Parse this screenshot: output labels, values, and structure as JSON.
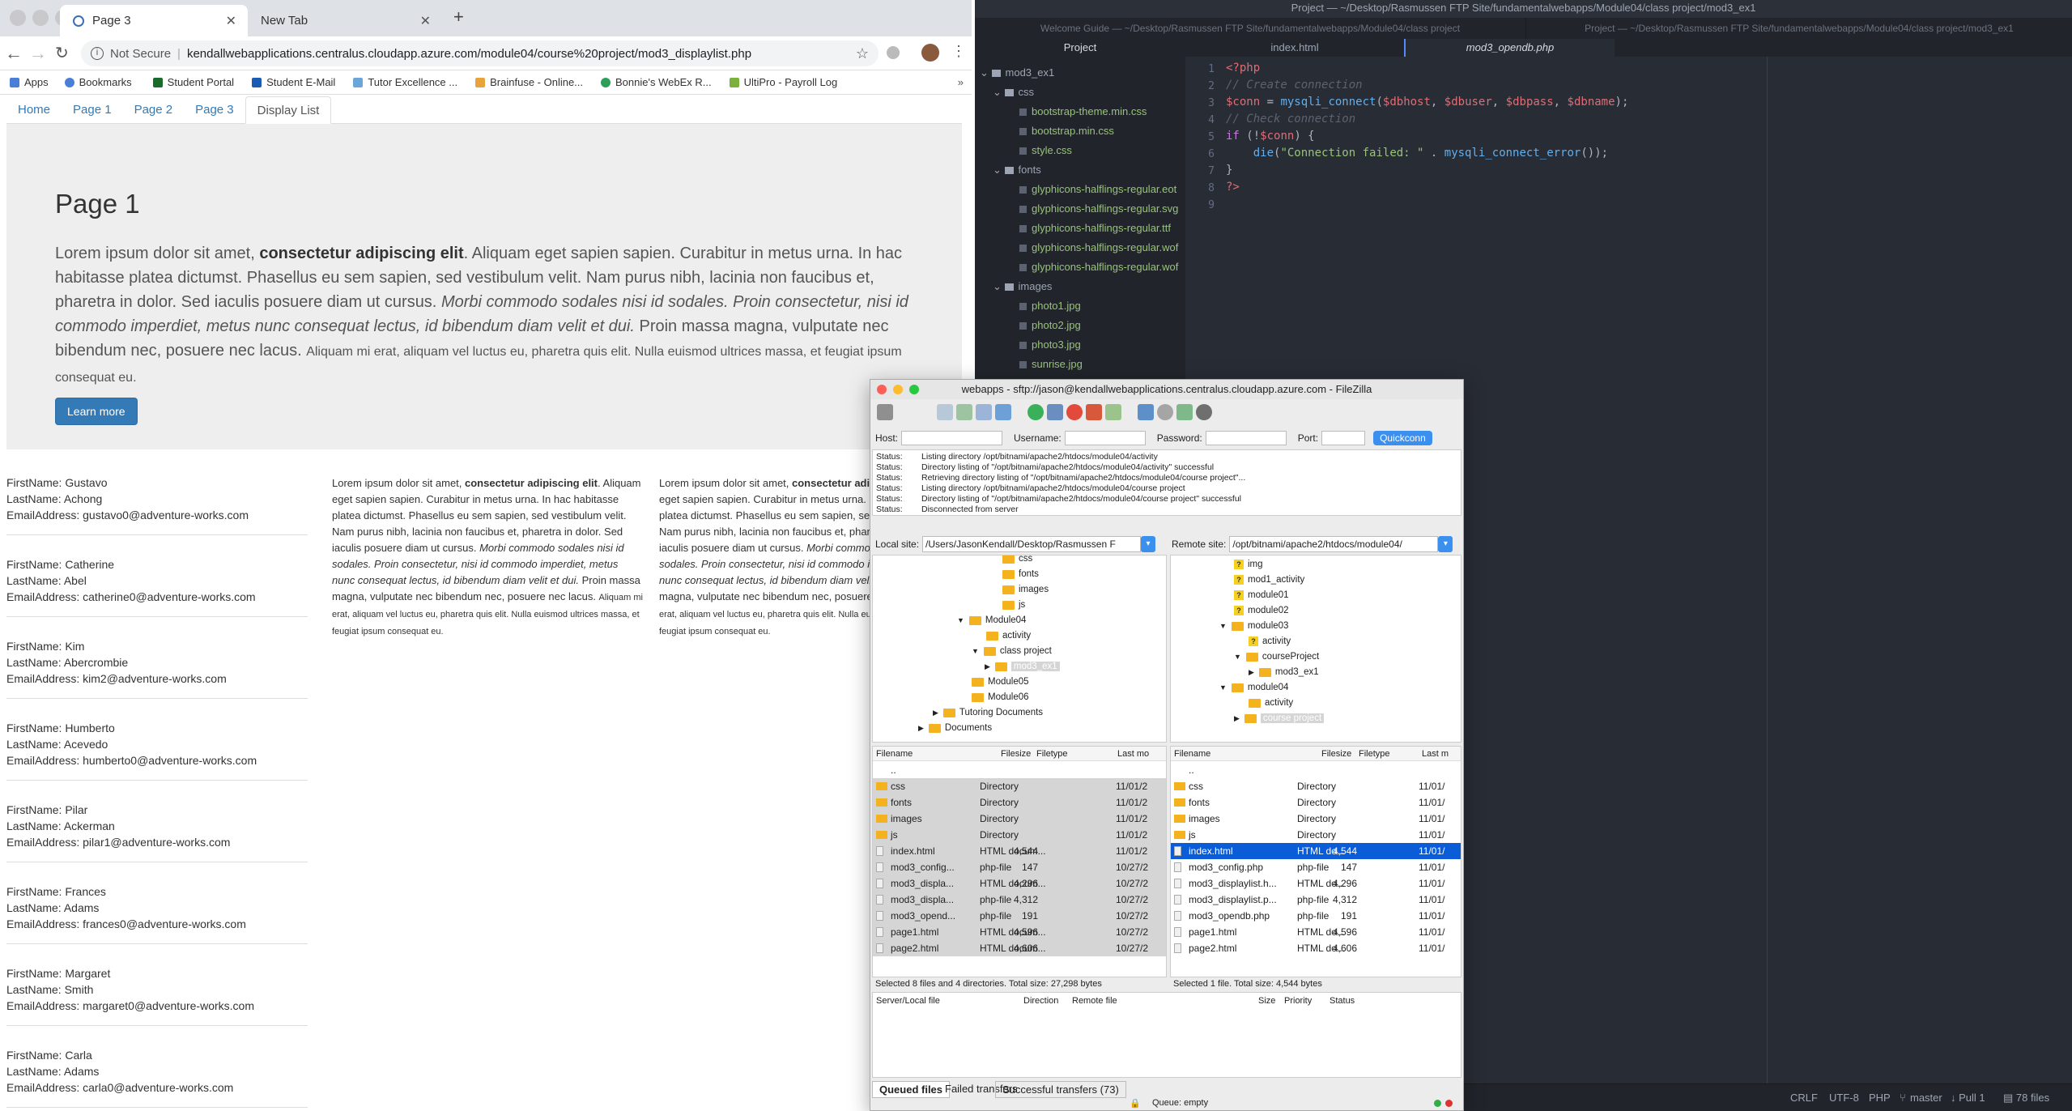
{
  "chrome": {
    "tabs": [
      {
        "title": "Page 3"
      },
      {
        "title": "New Tab"
      }
    ],
    "not_secure": "Not Secure",
    "url": "kendallwebapplications.centralus.cloudapp.azure.com/module04/course%20project/mod3_displaylist.php",
    "bookmarks": [
      "Apps",
      "Bookmarks",
      "Student Portal",
      "Student E-Mail",
      "Tutor Excellence ...",
      "Brainfuse - Online...",
      "Bonnie's WebEx R...",
      "UltiPro - Payroll Log"
    ]
  },
  "site": {
    "nav": [
      "Home",
      "Page 1",
      "Page 2",
      "Page 3",
      "Display List"
    ],
    "jumbo_title": "Page 1",
    "lead": {
      "p1": "Lorem ipsum dolor sit amet, ",
      "b1": "consectetur adipiscing elit",
      "p2": ". Aliquam eget sapien sapien. Curabitur in metus urna. In hac habitasse platea dictumst. Phasellus eu sem sapien, sed vestibulum velit. Nam purus nibh, lacinia non faucibus et, pharetra in dolor. Sed iaculis posuere diam ut cursus. ",
      "i1": "Morbi commodo sodales nisi id sodales. Proin consectetur, nisi id commodo imperdiet, metus nunc consequat lectus, id bibendum diam velit et dui.",
      "p3": " Proin massa magna, vulputate nec bibendum nec, posuere nec lacus. ",
      "s1": "Aliquam mi erat, aliquam vel luctus eu, pharetra quis elit. Nulla euismod ultrices massa, et feugiat ipsum consequat eu."
    },
    "learn_more": "Learn more",
    "people": [
      {
        "first": "FirstName: Gustavo",
        "last": "LastName: Achong",
        "email": "EmailAddress: gustavo0@adventure-works.com"
      },
      {
        "first": "FirstName: Catherine",
        "last": "LastName: Abel",
        "email": "EmailAddress: catherine0@adventure-works.com"
      },
      {
        "first": "FirstName: Kim",
        "last": "LastName: Abercrombie",
        "email": "EmailAddress: kim2@adventure-works.com"
      },
      {
        "first": "FirstName: Humberto",
        "last": "LastName: Acevedo",
        "email": "EmailAddress: humberto0@adventure-works.com"
      },
      {
        "first": "FirstName: Pilar",
        "last": "LastName: Ackerman",
        "email": "EmailAddress: pilar1@adventure-works.com"
      },
      {
        "first": "FirstName: Frances",
        "last": "LastName: Adams",
        "email": "EmailAddress: frances0@adventure-works.com"
      },
      {
        "first": "FirstName: Margaret",
        "last": "LastName: Smith",
        "email": "EmailAddress: margaret0@adventure-works.com"
      },
      {
        "first": "FirstName: Carla",
        "last": "LastName: Adams",
        "email": "EmailAddress: carla0@adventure-works.com"
      }
    ],
    "col": {
      "p1": "Lorem ipsum dolor sit amet, ",
      "b1": "consectetur adipiscing elit",
      "p2": ". Aliquam eget sapien sapien. Curabitur in metus urna. In hac habitasse platea dictumst. Phasellus eu sem sapien, sed vestibulum velit. Nam purus nibh, lacinia non faucibus et, pharetra in dolor. Sed iaculis posuere diam ut cursus. ",
      "i1": "Morbi commodo sodales nisi id sodales. Proin consectetur, nisi id commodo imperdiet, metus nunc consequat lectus, id bibendum diam velit et dui.",
      "p3": " Proin massa magna, vulputate nec bibendum nec, posuere nec lacus. ",
      "s1": "Aliquam mi erat, aliquam vel luctus eu, pharetra quis elit. Nulla euismod ultrices massa, et feugiat ipsum consequat eu."
    }
  },
  "atom": {
    "title": "Project — ~/Desktop/Rasmussen FTP Site/fundamentalwebapps/Module04/class project/mod3_ex1",
    "win_tab_1": "Welcome Guide — ~/Desktop/Rasmussen FTP Site/fundamentalwebapps/Module04/class project",
    "win_tab_2": "Project — ~/Desktop/Rasmussen FTP Site/fundamentalwebapps/Module04/class project/mod3_ex1",
    "tree_tab": "Project",
    "editor_tabs": [
      "index.html",
      "mod3_opendb.php"
    ],
    "tree": {
      "root": "mod3_ex1",
      "css": "css",
      "css_files": [
        "bootstrap-theme.min.css",
        "bootstrap.min.css",
        "style.css"
      ],
      "fonts": "fonts",
      "font_files": [
        "glyphicons-halflings-regular.eot",
        "glyphicons-halflings-regular.svg",
        "glyphicons-halflings-regular.ttf",
        "glyphicons-halflings-regular.wof",
        "glyphicons-halflings-regular.wof"
      ],
      "images": "images",
      "image_files": [
        "photo1.jpg",
        "photo2.jpg",
        "photo3.jpg",
        "sunrise.jpg"
      ]
    },
    "line_numbers": [
      "1",
      "2",
      "3",
      "4",
      "5",
      "6",
      "7",
      "8",
      "9"
    ],
    "code": {
      "l1": "<?php",
      "l2": "// Create connection",
      "l3a": "$conn",
      "l3b": " = ",
      "l3c": "mysqli_connect",
      "l3d": "(",
      "l3e": "$dbhost",
      "l3f": ", ",
      "l3g": "$dbuser",
      "l3h": ", ",
      "l3i": "$dbpass",
      "l3j": ", ",
      "l3k": "$dbname",
      "l3l": ");",
      "l4": "// Check connection",
      "l5a": "if",
      "l5b": " (!",
      "l5c": "$conn",
      "l5d": ") {",
      "l6a": "    die",
      "l6b": "(",
      "l6c": "\"Connection failed: \"",
      "l6d": " . ",
      "l6e": "mysqli_connect_error",
      "l6f": "());",
      "l7": "}",
      "l8": "?>"
    },
    "status": {
      "crlf": "CRLF",
      "enc": "UTF-8",
      "grammar": "PHP",
      "branch": "master",
      "pull": "Pull 1",
      "files": "78 files"
    }
  },
  "fz": {
    "title": "webapps - sftp://jason@kendallwebapplications.centralus.cloudapp.azure.com - FileZilla",
    "host_label": "Host:",
    "user_label": "Username:",
    "pass_label": "Password:",
    "port_label": "Port:",
    "quickconnect": "Quickconn",
    "log": [
      {
        "label": "Status:",
        "msg": "Listing directory /opt/bitnami/apache2/htdocs/module04/activity"
      },
      {
        "label": "Status:",
        "msg": "Directory listing of \"/opt/bitnami/apache2/htdocs/module04/activity\" successful"
      },
      {
        "label": "Status:",
        "msg": "Retrieving directory listing of \"/opt/bitnami/apache2/htdocs/module04/course project\"..."
      },
      {
        "label": "Status:",
        "msg": "Listing directory /opt/bitnami/apache2/htdocs/module04/course project"
      },
      {
        "label": "Status:",
        "msg": "Directory listing of \"/opt/bitnami/apache2/htdocs/module04/course project\" successful"
      },
      {
        "label": "Status:",
        "msg": "Disconnected from server"
      },
      {
        "label": "Status:",
        "msg": "Disconnected from server"
      }
    ],
    "local_label": "Local site:",
    "local_path": "/Users/JasonKendall/Desktop/Rasmussen F",
    "remote_label": "Remote site:",
    "remote_path": "/opt/bitnami/apache2/htdocs/module04/",
    "local_tree": [
      "css",
      "fonts",
      "images",
      "js",
      "Module04",
      "activity",
      "class project",
      "mod3_ex1",
      "Module05",
      "Module06",
      "Tutoring Documents",
      "Documents"
    ],
    "remote_tree": [
      "img",
      "mod1_activity",
      "module01",
      "module02",
      "module03",
      "activity",
      "courseProject",
      "mod3_ex1",
      "module04",
      "activity",
      "course project"
    ],
    "headers": {
      "name": "Filename",
      "size": "Filesize",
      "type": "Filetype",
      "local_mod": "Last mo",
      "remote_mod": "Last m"
    },
    "local_files": [
      {
        "name": "..",
        "size": "",
        "type": "",
        "mod": ""
      },
      {
        "name": "css",
        "size": "",
        "type": "Directory",
        "mod": "11/01/2"
      },
      {
        "name": "fonts",
        "size": "",
        "type": "Directory",
        "mod": "11/01/2"
      },
      {
        "name": "images",
        "size": "",
        "type": "Directory",
        "mod": "11/01/2"
      },
      {
        "name": "js",
        "size": "",
        "type": "Directory",
        "mod": "11/01/2"
      },
      {
        "name": "index.html",
        "size": "4,544",
        "type": "HTML docum...",
        "mod": "11/01/2"
      },
      {
        "name": "mod3_config...",
        "size": "147",
        "type": "php-file",
        "mod": "10/27/2"
      },
      {
        "name": "mod3_displa...",
        "size": "4,296",
        "type": "HTML docum...",
        "mod": "10/27/2"
      },
      {
        "name": "mod3_displa...",
        "size": "4,312",
        "type": "php-file",
        "mod": "10/27/2"
      },
      {
        "name": "mod3_opend...",
        "size": "191",
        "type": "php-file",
        "mod": "10/27/2"
      },
      {
        "name": "page1.html",
        "size": "4,596",
        "type": "HTML docum...",
        "mod": "10/27/2"
      },
      {
        "name": "page2.html",
        "size": "4,606",
        "type": "HTML docum...",
        "mod": "10/27/2"
      }
    ],
    "remote_files": [
      {
        "name": "..",
        "size": "",
        "type": "",
        "mod": ""
      },
      {
        "name": "css",
        "size": "",
        "type": "Directory",
        "mod": "11/01/"
      },
      {
        "name": "fonts",
        "size": "",
        "type": "Directory",
        "mod": "11/01/"
      },
      {
        "name": "images",
        "size": "",
        "type": "Directory",
        "mod": "11/01/"
      },
      {
        "name": "js",
        "size": "",
        "type": "Directory",
        "mod": "11/01/"
      },
      {
        "name": "index.html",
        "size": "4,544",
        "type": "HTML do...",
        "mod": "11/01/"
      },
      {
        "name": "mod3_config.php",
        "size": "147",
        "type": "php-file",
        "mod": "11/01/"
      },
      {
        "name": "mod3_displaylist.h...",
        "size": "4,296",
        "type": "HTML do...",
        "mod": "11/01/"
      },
      {
        "name": "mod3_displaylist.p...",
        "size": "4,312",
        "type": "php-file",
        "mod": "11/01/"
      },
      {
        "name": "mod3_opendb.php",
        "size": "191",
        "type": "php-file",
        "mod": "11/01/"
      },
      {
        "name": "page1.html",
        "size": "4,596",
        "type": "HTML do...",
        "mod": "11/01/"
      },
      {
        "name": "page2.html",
        "size": "4,606",
        "type": "HTML do...",
        "mod": "11/01/"
      }
    ],
    "local_summary": "Selected 8 files and 4 directories. Total size: 27,298 bytes",
    "remote_summary": "Selected 1 file. Total size: 4,544 bytes",
    "queue_headers": [
      "Server/Local file",
      "Direction",
      "Remote file",
      "Size",
      "Priority",
      "Status"
    ],
    "queue_tabs": [
      "Queued files",
      "Failed transfers",
      "Successful transfers (73)"
    ],
    "queue_status": "Queue: empty"
  }
}
